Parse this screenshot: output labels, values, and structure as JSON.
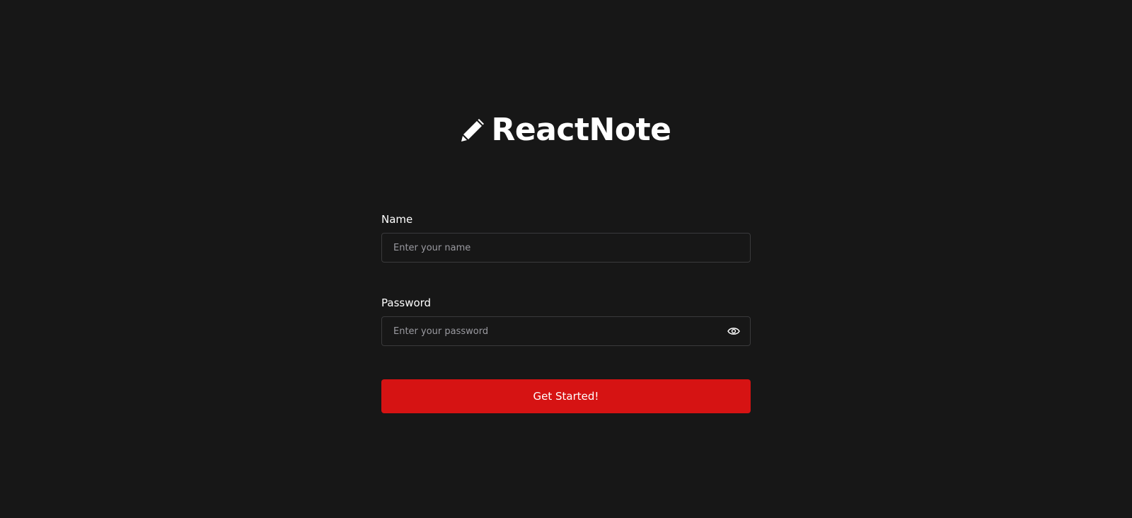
{
  "brand": {
    "name": "ReactNote",
    "icon": "pencil-icon"
  },
  "form": {
    "name_label": "Name",
    "name_placeholder": "Enter your name",
    "name_value": "",
    "password_label": "Password",
    "password_placeholder": "Enter your password",
    "password_value": "",
    "toggle_icon": "eye-icon",
    "submit_label": "Get Started!"
  },
  "colors": {
    "background": "#171717",
    "accent": "#d61313",
    "input_border": "#3a3a3c",
    "placeholder": "#9a9aa0"
  }
}
